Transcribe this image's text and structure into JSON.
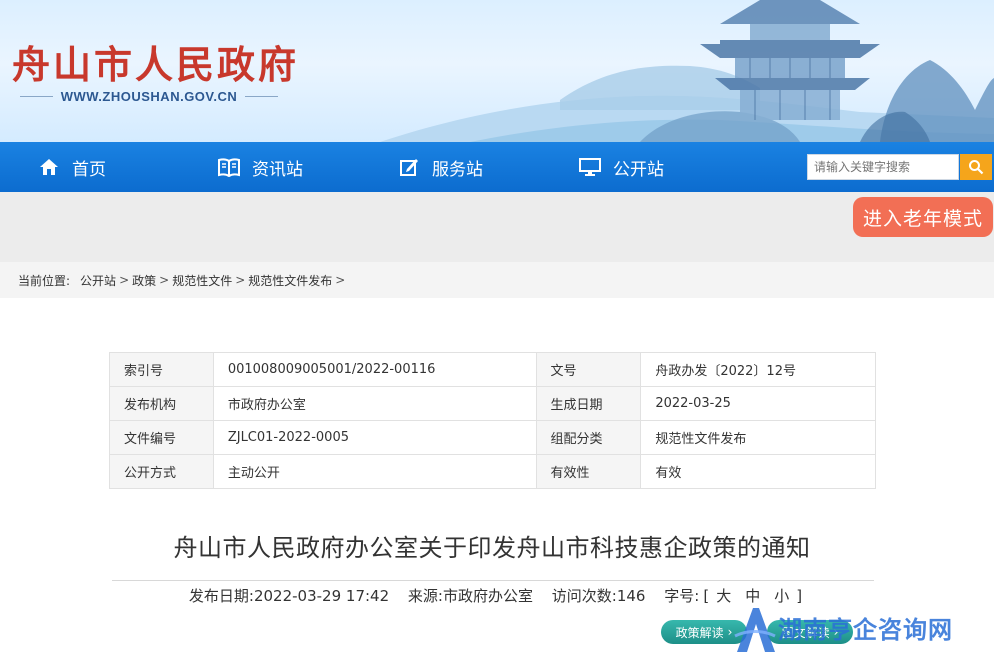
{
  "header": {
    "site_title": "舟山市人民政府",
    "site_url": "WWW.ZHOUSHAN.GOV.CN"
  },
  "nav": {
    "items": [
      {
        "label": "首页",
        "icon": "home-icon"
      },
      {
        "label": "资讯站",
        "icon": "book-icon"
      },
      {
        "label": "服务站",
        "icon": "edit-icon"
      },
      {
        "label": "公开站",
        "icon": "monitor-icon"
      }
    ],
    "search_placeholder": "请输入关键字搜索",
    "search_icon": "search-icon"
  },
  "elder_mode_label": "进入老年模式",
  "breadcrumb": {
    "label": "当前位置:",
    "items": [
      "公开站",
      "政策",
      "规范性文件",
      "规范性文件发布"
    ],
    "separator": ">"
  },
  "meta": {
    "rows": [
      {
        "k1": "索引号",
        "v1": "001008009005001/2022-00116",
        "k2": "文号",
        "v2": "舟政办发〔2022〕12号"
      },
      {
        "k1": "发布机构",
        "v1": "市政府办公室",
        "k2": "生成日期",
        "v2": "2022-03-25"
      },
      {
        "k1": "文件编号",
        "v1": "ZJLC01-2022-0005",
        "k2": "组配分类",
        "v2": "规范性文件发布"
      },
      {
        "k1": "公开方式",
        "v1": "主动公开",
        "k2": "有效性",
        "v2": "有效"
      }
    ]
  },
  "article": {
    "title": "舟山市人民政府办公室关于印发舟山市科技惠企政策的通知",
    "publish_date_label": "发布日期:",
    "publish_date": "2022-03-29 17:42",
    "source_label": "来源:",
    "source": "市政府办公室",
    "visits_label": "访问次数:",
    "visits": "146",
    "font_size_label": "字号:",
    "font_size_open": "[",
    "font_sizes": [
      "大",
      "中",
      "小"
    ],
    "font_size_close": "]"
  },
  "read_buttons": {
    "policy": "政策解读",
    "graphic": "图文解读",
    "arrow": "›"
  },
  "watermark": {
    "text": "湖南亨企咨询网"
  },
  "colors": {
    "nav_blue": "#0c6ccf",
    "title_red": "#c8382c",
    "elder_btn": "#f26f55",
    "search_btn": "#f5a51b",
    "read_btn": "#1e8f88"
  }
}
